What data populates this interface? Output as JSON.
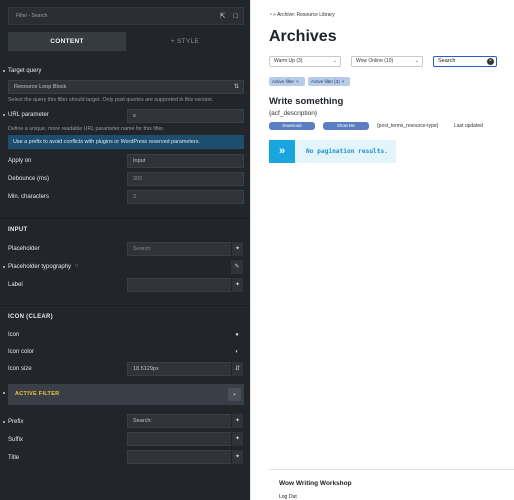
{
  "editor": {
    "topbar": {
      "title": "Filter - Search"
    },
    "tabs": {
      "content": "CONTENT",
      "style": "+ STYLE"
    },
    "target_query": {
      "label": "Target query",
      "value": "Resource Loop Block",
      "help": "Select the query this filter should target. Only post queries are supported in this version."
    },
    "url_parameter": {
      "label": "URL parameter",
      "value": "s",
      "help": "Define a unique, more readable URL parameter name for this filter.",
      "info": "Use a prefix to avoid conflicts with plugins or WordPress reserved parameters."
    },
    "apply_on": {
      "label": "Apply on",
      "value": "Input"
    },
    "debounce": {
      "label": "Debounce (ms)",
      "placeholder": "300"
    },
    "min_characters": {
      "label": "Min. characters",
      "placeholder": "3"
    },
    "input_section": {
      "heading": "INPUT",
      "placeholder_label": "Placeholder",
      "placeholder_value": "Search",
      "typography_label": "Placeholder typography",
      "label_label": "Label"
    },
    "icon_section": {
      "heading": "ICON (CLEAR)",
      "icon_label": "Icon",
      "icon_color_label": "Icon color",
      "icon_size_label": "Icon size",
      "icon_size_value": "18.5129px"
    },
    "active_filter": {
      "heading": "ACTIVE FILTER"
    },
    "prefix": {
      "label": "Prefix",
      "value": "Search:"
    },
    "suffix": {
      "label": "Suffix"
    },
    "title": {
      "label": "Title"
    }
  },
  "preview": {
    "breadcrumb": {
      "home": "•",
      "separator": "»",
      "current": "Archive: Resource Library"
    },
    "page_title": "Archives",
    "filters": {
      "warm_up": "Warm Up (3)",
      "wow_online": "Wow Online (10)",
      "search_value": "Search"
    },
    "chips": [
      "Active filter",
      "Active filter (3)"
    ],
    "post": {
      "title": "Write something",
      "description": "{acf_description}",
      "download_label": "Download",
      "show_me_label": "Show Me",
      "terms": "{post_terms_resource-type}",
      "updated": "Last updated"
    },
    "pagination": {
      "message": "No pagination results."
    },
    "footer": {
      "title": "Wow Writing Workshop",
      "logout": "Log Out"
    }
  },
  "colors": {
    "panel_bg": "#22252a",
    "control_bg": "#30343a",
    "accent_yellow": "#f0c33c",
    "info_bg": "#1d4e6d",
    "chip_bg": "#b8cbe8",
    "button_bg": "#5b7ec2",
    "pagination_accent": "#19a6df"
  }
}
